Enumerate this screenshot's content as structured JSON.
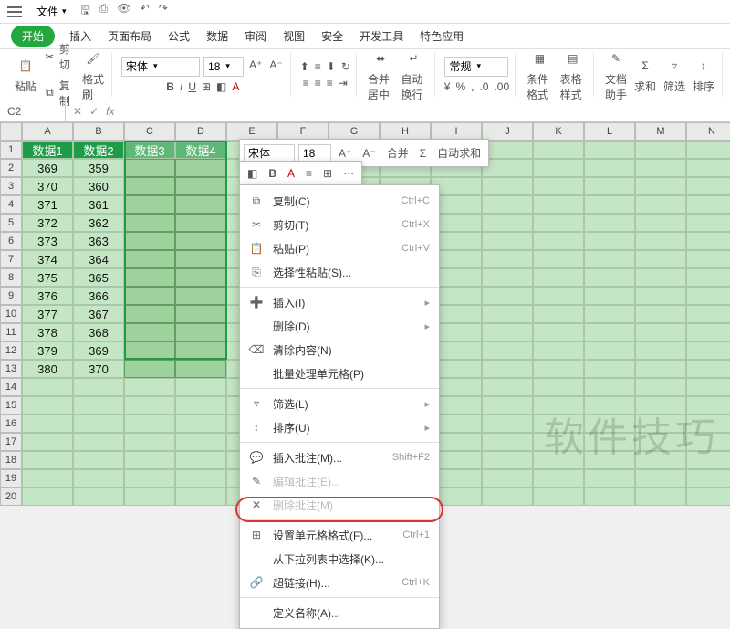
{
  "titlebar": {
    "file_label": "文件",
    "dropdown": "▾"
  },
  "tabs": {
    "t0": "开始",
    "t1": "插入",
    "t2": "页面布局",
    "t3": "公式",
    "t4": "数据",
    "t5": "审阅",
    "t6": "视图",
    "t7": "安全",
    "t8": "开发工具",
    "t9": "特色应用"
  },
  "ribbon": {
    "paste": "粘贴",
    "cut": "剪切",
    "copy": "复制",
    "format_painter": "格式刷",
    "font_name": "宋体",
    "font_size": "18",
    "num_format": "常规",
    "merge_center": "合并居中",
    "wrap": "自动换行",
    "cond_fmt": "条件格式",
    "table_style": "表格样式",
    "doc_assist": "文档助手",
    "autosum": "求和",
    "filter": "筛选",
    "sort": "排序"
  },
  "formula_bar": {
    "name_box": "C2",
    "fx": "fx"
  },
  "columns": [
    "A",
    "B",
    "C",
    "D",
    "E",
    "F",
    "G",
    "H",
    "I",
    "J",
    "K",
    "L",
    "M",
    "N"
  ],
  "rows": [
    "1",
    "2",
    "3",
    "4",
    "5",
    "6",
    "7",
    "8",
    "9",
    "10",
    "11",
    "12",
    "13",
    "14",
    "15",
    "16",
    "17",
    "18",
    "19",
    "20"
  ],
  "headers": {
    "h1": "数据1",
    "h2": "数据2",
    "h3": "数据3",
    "h4": "数据4"
  },
  "chart_data": {
    "type": "table",
    "columns": [
      "数据1",
      "数据2"
    ],
    "rows": [
      [
        369,
        359
      ],
      [
        370,
        360
      ],
      [
        371,
        361
      ],
      [
        372,
        362
      ],
      [
        373,
        363
      ],
      [
        374,
        364
      ],
      [
        375,
        365
      ],
      [
        376,
        366
      ],
      [
        377,
        367
      ],
      [
        378,
        368
      ],
      [
        379,
        369
      ],
      [
        380,
        370
      ]
    ]
  },
  "mini_toolbar": {
    "font": "宋体",
    "size": "18",
    "merge": "合并",
    "autosum": "自动求和"
  },
  "context_menu": {
    "copy": "复制(C)",
    "copy_sc": "Ctrl+C",
    "cut": "剪切(T)",
    "cut_sc": "Ctrl+X",
    "paste": "粘贴(P)",
    "paste_sc": "Ctrl+V",
    "paste_special": "选择性粘贴(S)...",
    "insert": "插入(I)",
    "delete": "删除(D)",
    "clear": "清除内容(N)",
    "batch": "批量处理单元格(P)",
    "filter": "筛选(L)",
    "sort": "排序(U)",
    "insert_comment": "插入批注(M)...",
    "insert_comment_sc": "Shift+F2",
    "edit_comment": "编辑批注(E)...",
    "delete_comment": "删除批注(M)",
    "format_cells": "设置单元格格式(F)...",
    "format_cells_sc": "Ctrl+1",
    "pick_list": "从下拉列表中选择(K)...",
    "hyperlink": "超链接(H)...",
    "hyperlink_sc": "Ctrl+K",
    "define_name": "定义名称(A)..."
  },
  "watermark": "软件技巧"
}
